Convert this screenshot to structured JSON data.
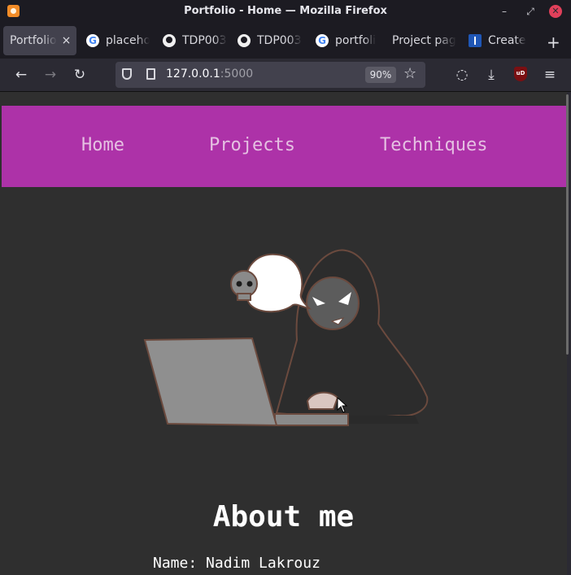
{
  "window": {
    "title": "Portfolio - Home — Mozilla Firefox",
    "app_icon": "firefox-icon",
    "minimize_icon": "–",
    "restore_icon": "⤢",
    "close_icon": "✕"
  },
  "tabs": [
    {
      "label": "Portfolio",
      "active": true,
      "favicon": "firefox-icon",
      "close": "×"
    },
    {
      "label": "placeho",
      "favicon": "google-icon"
    },
    {
      "label": "TDP003",
      "favicon": "github-icon"
    },
    {
      "label": "TDP003",
      "favicon": "github-icon"
    },
    {
      "label": "portfoli",
      "favicon": "google-icon"
    },
    {
      "label": "Project pag",
      "favicon": "none"
    },
    {
      "label": "Create",
      "favicon": "blue-square-icon"
    }
  ],
  "toolbar": {
    "new_tab": "+",
    "back": "←",
    "forward": "→",
    "reload": "↻",
    "url_host": "127.0.0.1",
    "url_port": ":5000",
    "zoom": "90%",
    "bookmark_star": "☆",
    "pocket": "◌",
    "download": "⤓",
    "ublock": "uD",
    "menu": "≡"
  },
  "page": {
    "nav": [
      "Home",
      "Projects",
      "Techniques"
    ],
    "nav_color": "#ad32a8",
    "background": "#2f2f2f",
    "hero_image": "hacker-with-laptop-illustration",
    "about_title": "About me",
    "about_name": "Name: Nadim Lakrouz"
  }
}
